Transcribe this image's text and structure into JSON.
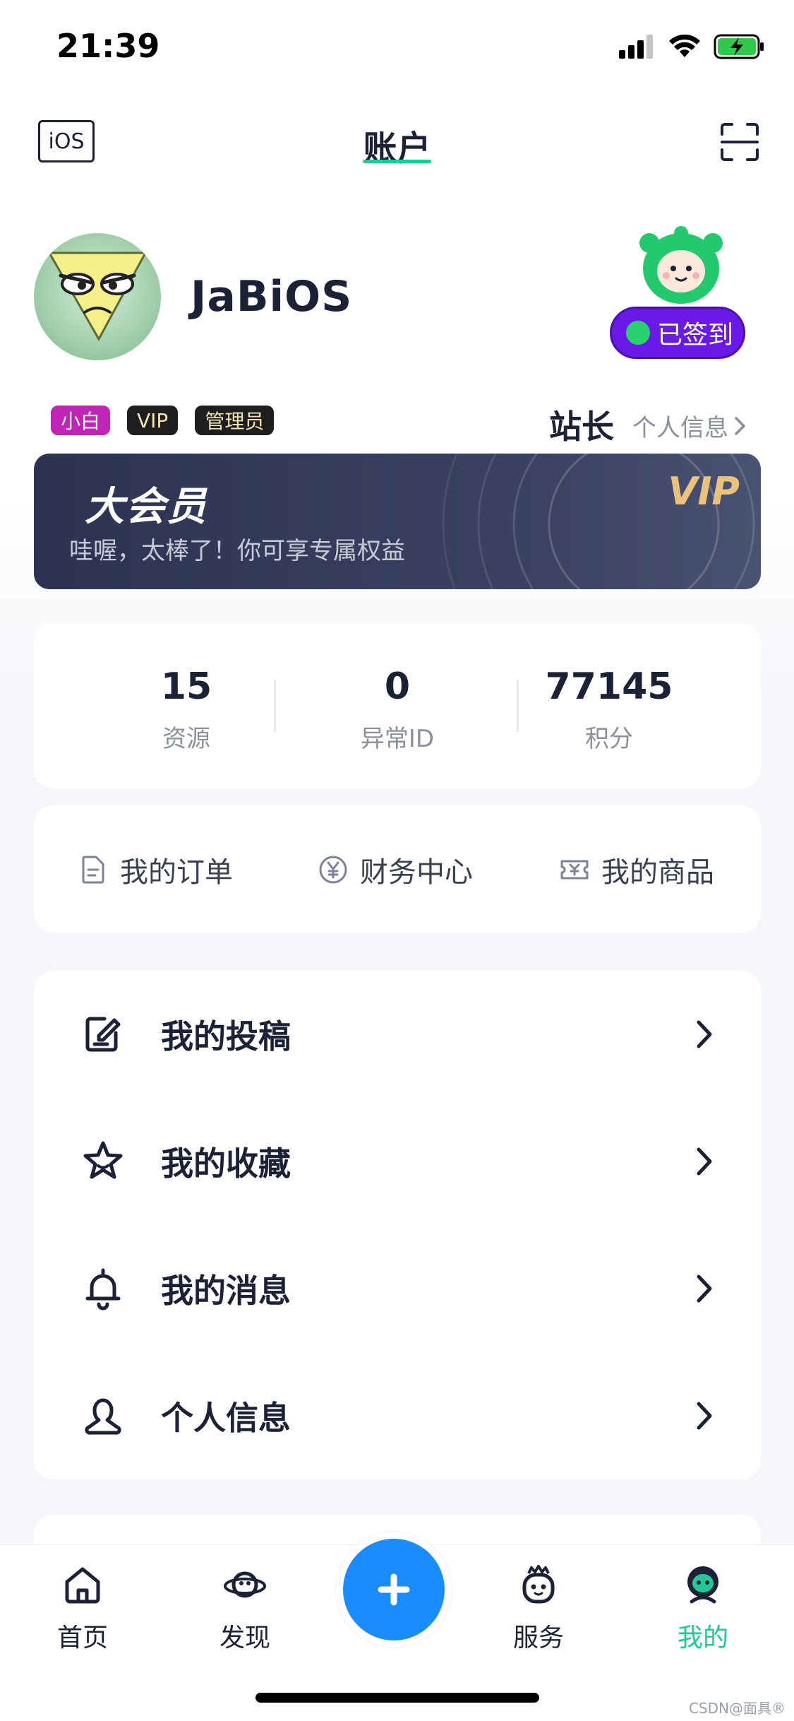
{
  "status_bar": {
    "time": "21:39"
  },
  "nav": {
    "left_badge": "iOS",
    "title": "账户"
  },
  "profile": {
    "username": "JaBiOS",
    "checkin_label": "已签到",
    "tags": [
      "小白",
      "VIP",
      "管理员"
    ],
    "role": "站长",
    "info_link": "个人信息"
  },
  "vip_banner": {
    "title": "大会员",
    "subtitle": "哇喔，太棒了！你可享专属权益",
    "logo": "VIP"
  },
  "stats": [
    {
      "value": "15",
      "label": "资源"
    },
    {
      "value": "0",
      "label": "异常ID"
    },
    {
      "value": "77145",
      "label": "积分"
    }
  ],
  "quick_links": [
    {
      "label": "我的订单",
      "icon": "document-icon"
    },
    {
      "label": "财务中心",
      "icon": "yen-coin-icon"
    },
    {
      "label": "我的商品",
      "icon": "ticket-icon"
    }
  ],
  "menu": [
    {
      "label": "我的投稿",
      "icon": "edit-note-icon"
    },
    {
      "label": "我的收藏",
      "icon": "star-icon"
    },
    {
      "label": "我的消息",
      "icon": "bell-icon"
    },
    {
      "label": "个人信息",
      "icon": "user-icon"
    }
  ],
  "tab_bar": [
    {
      "label": "首页",
      "icon": "home-icon"
    },
    {
      "label": "发现",
      "icon": "planet-icon"
    },
    {
      "label": "服务",
      "icon": "robot-icon"
    },
    {
      "label": "我的",
      "icon": "mascot-icon",
      "active": true
    }
  ],
  "colors": {
    "accent": "#20c997",
    "checkin": "#6a1ae8",
    "add_button": "#1a8cff"
  },
  "watermark": "CSDN@面具®"
}
